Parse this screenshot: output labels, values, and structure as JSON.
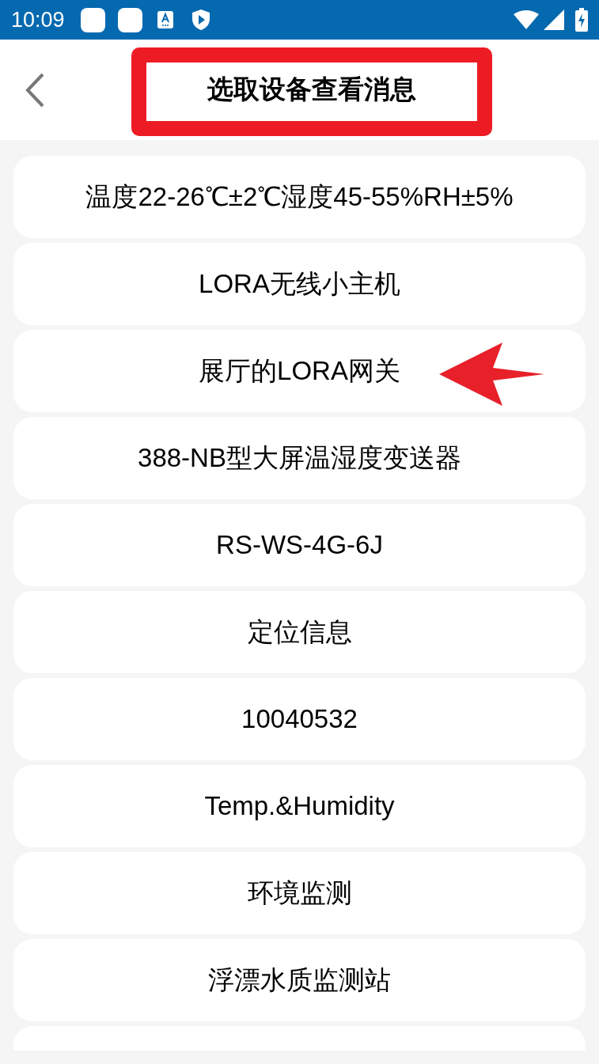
{
  "status_bar": {
    "time": "10:09"
  },
  "header": {
    "title": "选取设备查看消息"
  },
  "devices": [
    {
      "name": "温度22-26℃±2℃湿度45-55%RH±5%",
      "highlighted": false
    },
    {
      "name": "LORA无线小主机",
      "highlighted": false
    },
    {
      "name": "展厅的LORA网关",
      "highlighted": true
    },
    {
      "name": "388-NB型大屏温湿度变送器",
      "highlighted": false
    },
    {
      "name": "RS-WS-4G-6J",
      "highlighted": false
    },
    {
      "name": "定位信息",
      "highlighted": false
    },
    {
      "name": "10040532",
      "highlighted": false
    },
    {
      "name": "Temp.&Humidity",
      "highlighted": false
    },
    {
      "name": "环境监测",
      "highlighted": false
    },
    {
      "name": "浮漂水质监测站",
      "highlighted": false
    }
  ]
}
